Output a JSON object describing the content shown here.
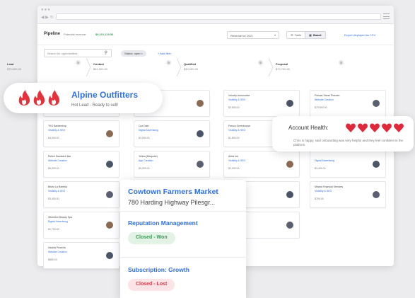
{
  "colors": {
    "accent": "#2f6fe0",
    "flame": "#e8303a",
    "heart": "#e0283a",
    "won": "#3a9a55",
    "lost": "#d63a4a",
    "revenue": "#3aa35a"
  },
  "topbar": {
    "title": "Pipeline",
    "revenue_label": "Potential revenue:",
    "revenue_value": "$9,201,119.56",
    "revenue_select": "Revenue for 2021",
    "view_table": "Table",
    "view_board": "Board",
    "export": "Export displayed as CSV"
  },
  "filters": {
    "search_placeholder": "Search for opportunities",
    "chip": "Status: open",
    "add_filter": "+ Add filter"
  },
  "stages": [
    {
      "name": "Lead",
      "amount": "$75,000.00",
      "count": "5"
    },
    {
      "name": "Contact",
      "amount": "$61,000.00",
      "count": "5"
    },
    {
      "name": "Qualified",
      "amount": "$30,000.00",
      "count": "5"
    },
    {
      "name": "Proposal",
      "amount": "$72,700.00",
      "count": "5"
    }
  ],
  "columns": [
    {
      "cards": [
        {
          "name": "",
          "type": "",
          "amount": ""
        },
        {
          "name": "TKO Barbershop",
          "type": "Visibility & SEO",
          "amount": "$4,000.00"
        },
        {
          "name": "Relish Sandwich Bar",
          "type": "Website Creation",
          "amount": "$5,000.00"
        },
        {
          "name": "Bistro La Rambla",
          "type": "Visibility & SEO",
          "amount": "$3,400.00"
        },
        {
          "name": "Wheelton Beauty Spa",
          "type": "Digital Advertising",
          "amount": "$1,700.00"
        },
        {
          "name": "Insanis Pizzeria",
          "type": "Website Creation",
          "amount": "$850.00"
        }
      ]
    },
    {
      "cards": [
        {
          "name": "",
          "type": "",
          "amount": ""
        },
        {
          "name": "Cox Dale",
          "type": "Digital Advertising",
          "amount": "$3,000.00"
        },
        {
          "name": "Yellow (Bespoke)",
          "type": "App Creation",
          "amount": "$9,000.00"
        }
      ]
    },
    {
      "cards": [
        {
          "name": "Velocity Automotive",
          "type": "Visibility & SEO",
          "amount": "$3,500.00"
        },
        {
          "name": "Fresco Greenhouse",
          "type": "Visibility & SEO",
          "amount": "$1,800.00"
        },
        {
          "name": "Artful Ink",
          "type": "Visibility & SEO",
          "amount": "$2,000.00"
        },
        {
          "name": "",
          "type": "",
          "amount": ""
        },
        {
          "name": "",
          "type": "",
          "amount": ""
        }
      ]
    },
    {
      "cards": [
        {
          "name": "Pelican Street Pictures",
          "type": "Website Creation",
          "amount": "$73,800.00"
        },
        {
          "name": "",
          "type": "",
          "amount": ""
        },
        {
          "name": "",
          "type": "Digital Advertising",
          "amount": "$3,400.00"
        },
        {
          "name": "Mirana Financial Services",
          "type": "Visibility & SEO",
          "amount": "$750.00"
        }
      ]
    }
  ],
  "alpine": {
    "name": "Alpine Outfitters",
    "sub": "Hot Lead - Ready to sell!"
  },
  "health": {
    "label": "Account Health:",
    "hearts": 5,
    "note": "Chris is happy, said onboarding was very helpful and they feel confident in the platform."
  },
  "cowtown": {
    "name": "Cowtown Farmers Market",
    "address": "780 Harding Highway Pilesgr...",
    "service1": "Reputation Management",
    "status1": "Closed - Won",
    "service2": "Subscription: Growth",
    "status2": "Closed - Lost"
  }
}
